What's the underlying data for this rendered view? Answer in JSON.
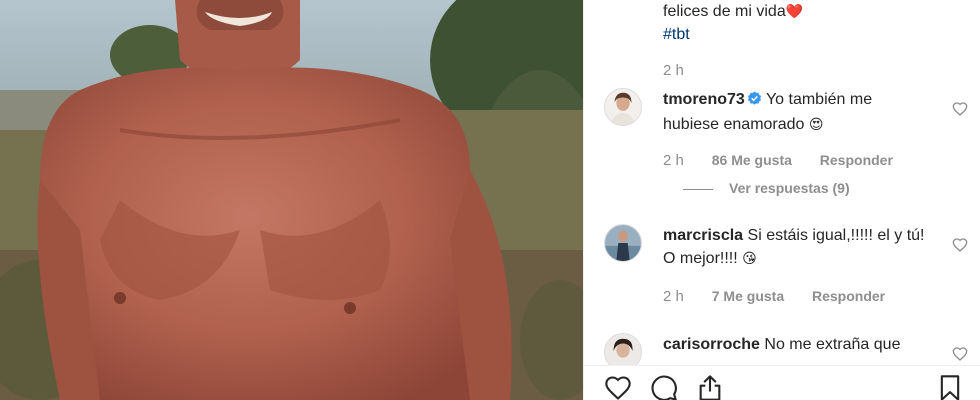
{
  "post": {
    "caption_line1": "felices de mi vida",
    "caption_hashtag": "#tbt",
    "caption_time": "2 h"
  },
  "comments": [
    {
      "username": "tmoreno73",
      "verified": true,
      "text": "Yo también me hubiese enamorado",
      "emoji": "😍",
      "time": "2 h",
      "likes": "86 Me gusta",
      "reply": "Responder",
      "view_replies": "Ver respuestas (9)"
    },
    {
      "username": "marcriscla",
      "verified": false,
      "text": "Si estáis igual,!!!!! el y tú! O mejor!!!!",
      "emoji": "😘",
      "time": "2 h",
      "likes": "7 Me gusta",
      "reply": "Responder"
    },
    {
      "username": "carisorroche",
      "verified": false,
      "text": "No me extraña que"
    }
  ],
  "icons": {
    "caption_heart": "red-heart-emoji",
    "like": "heart-outline-icon",
    "comment": "comment-bubble-icon",
    "share": "share-icon",
    "save": "bookmark-icon",
    "verified": "verified-badge-icon"
  },
  "colors": {
    "link": "#00376b",
    "muted": "#8e8e8e",
    "text": "#262626",
    "verified": "#3897f0"
  }
}
